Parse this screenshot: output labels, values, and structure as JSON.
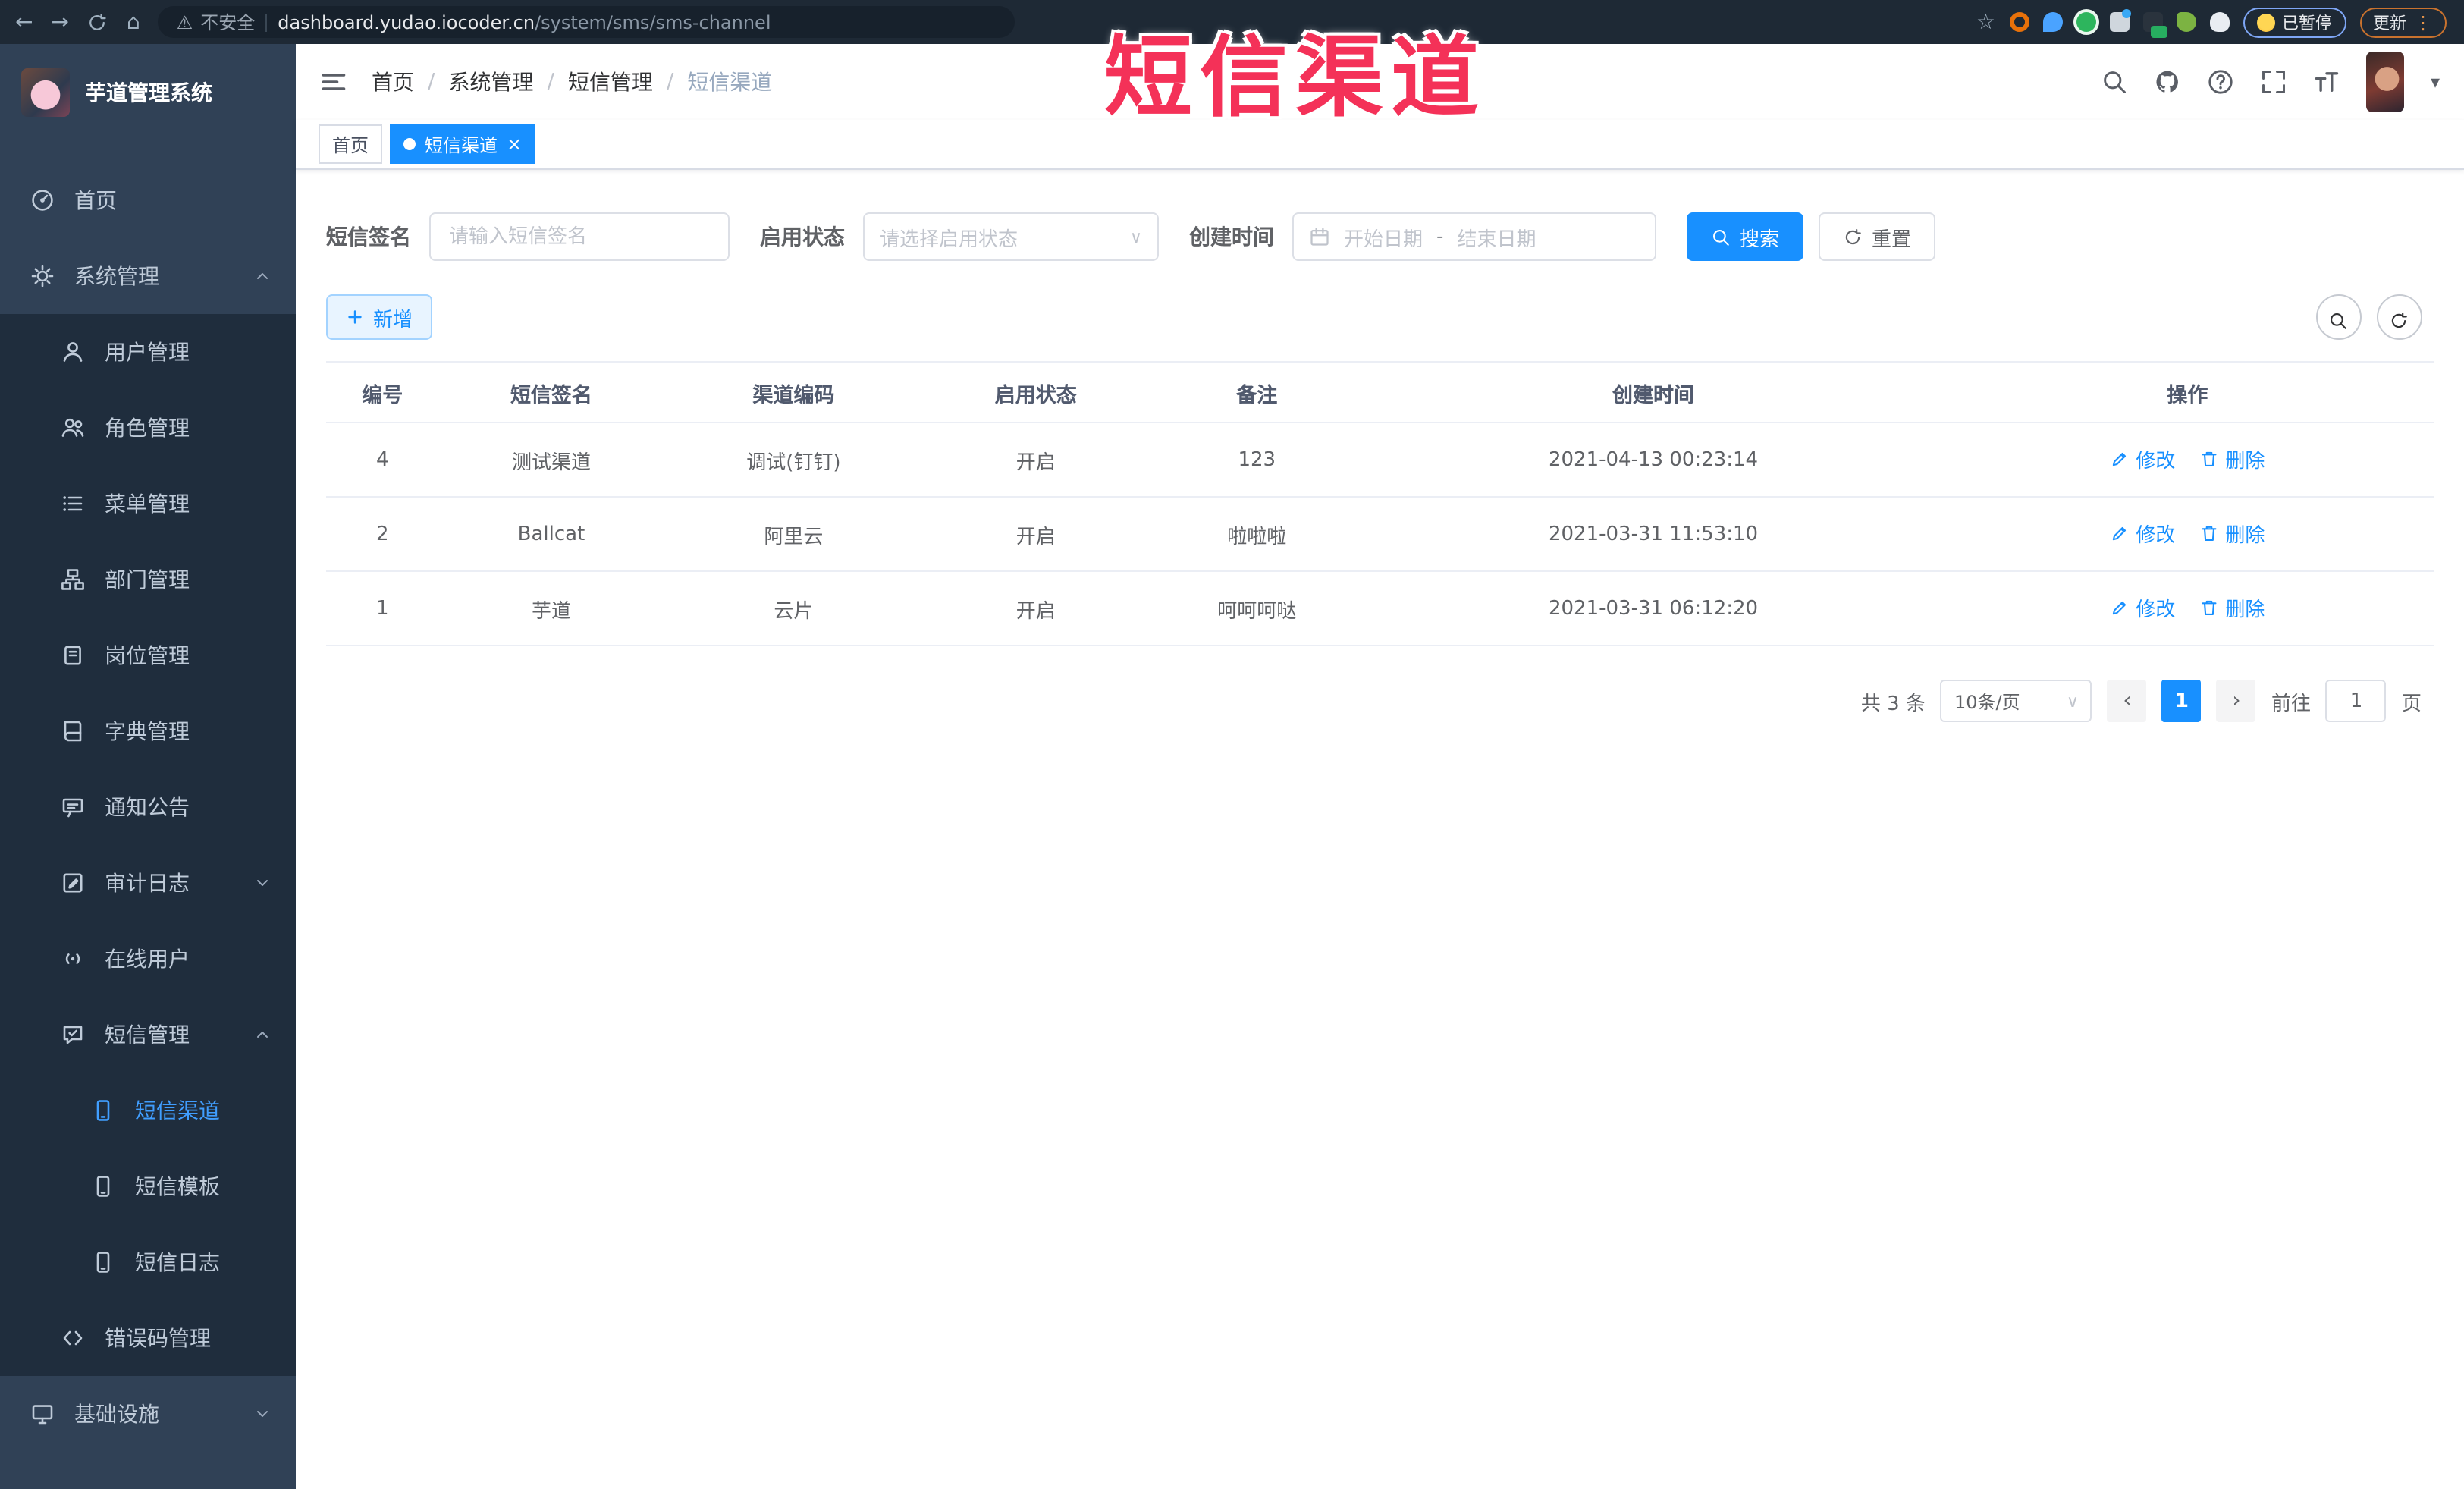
{
  "browser": {
    "security_label": "不安全",
    "url_host": "dashboard.yudao.iocoder.cn",
    "url_path": "/system/sms/sms-channel",
    "paused_label": "已暂停",
    "update_label": "更新"
  },
  "overlay": {
    "title": "短信渠道"
  },
  "icons": {
    "back": "←",
    "forward": "→",
    "home": "⌂",
    "warning": "⚠",
    "star": "☆",
    "more_vert": "⋮",
    "caret_down": "▾",
    "select_caret": "∨",
    "close": "×",
    "prev": "‹",
    "next": "›"
  },
  "sidebar": {
    "app_title": "芋道管理系统",
    "home_label": "首页",
    "system_label": "系统管理",
    "system_children": [
      "用户管理",
      "角色管理",
      "菜单管理",
      "部门管理",
      "岗位管理",
      "字典管理",
      "通知公告",
      "审计日志",
      "在线用户",
      "短信管理",
      "错误码管理"
    ],
    "sms_children": [
      "短信渠道",
      "短信模板",
      "短信日志"
    ],
    "infra_label": "基础设施"
  },
  "header": {
    "breadcrumb": [
      "首页",
      "系统管理",
      "短信管理",
      "短信渠道"
    ]
  },
  "tabs": [
    {
      "label": "首页",
      "active": false
    },
    {
      "label": "短信渠道",
      "active": true
    }
  ],
  "filters": {
    "sign_label": "短信签名",
    "sign_placeholder": "请输入短信签名",
    "status_label": "启用状态",
    "status_placeholder": "请选择启用状态",
    "time_label": "创建时间",
    "start_placeholder": "开始日期",
    "range_separator": "-",
    "end_placeholder": "结束日期",
    "search_label": "搜索",
    "reset_label": "重置"
  },
  "toolbar": {
    "add_label": "新增"
  },
  "table": {
    "headers": [
      "编号",
      "短信签名",
      "渠道编码",
      "启用状态",
      "备注",
      "创建时间",
      "操作"
    ],
    "rows": [
      {
        "id": "4",
        "sign": "测试渠道",
        "code": "调试(钉钉)",
        "status": "开启",
        "remark": "123",
        "time": "2021-04-13 00:23:14"
      },
      {
        "id": "2",
        "sign": "Ballcat",
        "code": "阿里云",
        "status": "开启",
        "remark": "啦啦啦",
        "time": "2021-03-31 11:53:10"
      },
      {
        "id": "1",
        "sign": "芋道",
        "code": "云片",
        "status": "开启",
        "remark": "呵呵呵哒",
        "time": "2021-03-31 06:12:20"
      }
    ],
    "action_edit": "修改",
    "action_delete": "删除"
  },
  "pagination": {
    "total": "共 3 条",
    "page_size": "10条/页",
    "current": "1",
    "goto_label": "前往",
    "goto_value": "1",
    "unit": "页"
  },
  "colors": {
    "accent": "#1890ff",
    "sidebar_bg": "#304156",
    "submenu_bg": "#1f2d3d",
    "active_text": "#409eff",
    "overlay_red": "#f43158"
  }
}
